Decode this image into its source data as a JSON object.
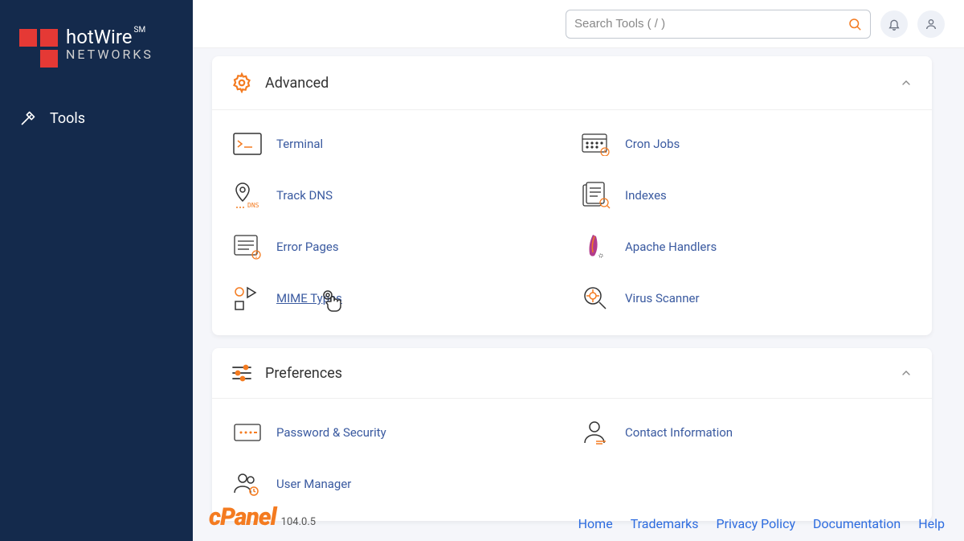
{
  "brand": {
    "name": "hotWire",
    "sub": "NETWORKS",
    "sm": "SM"
  },
  "sidebar": {
    "items": [
      {
        "label": "Tools"
      }
    ]
  },
  "topbar": {
    "search_placeholder": "Search Tools ( / )"
  },
  "panels": {
    "advanced": {
      "title": "Advanced",
      "items": [
        {
          "label": "Terminal"
        },
        {
          "label": "Cron Jobs"
        },
        {
          "label": "Track DNS"
        },
        {
          "label": "Indexes"
        },
        {
          "label": "Error Pages"
        },
        {
          "label": "Apache Handlers"
        },
        {
          "label": "MIME Types"
        },
        {
          "label": "Virus Scanner"
        }
      ]
    },
    "preferences": {
      "title": "Preferences",
      "items": [
        {
          "label": "Password & Security"
        },
        {
          "label": "Contact Information"
        },
        {
          "label": "User Manager"
        }
      ]
    }
  },
  "footer": {
    "product": "cPanel",
    "version": "104.0.5",
    "links": [
      "Home",
      "Trademarks",
      "Privacy Policy",
      "Documentation",
      "Help"
    ]
  }
}
